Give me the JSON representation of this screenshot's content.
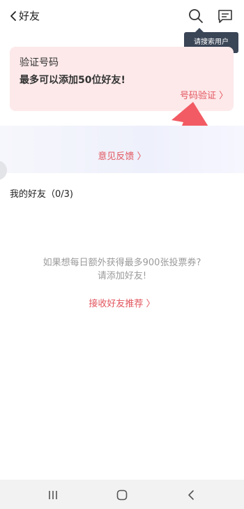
{
  "header": {
    "title": "好友",
    "back_icon": "chevron-left-icon",
    "search_icon": "search-icon",
    "message_icon": "message-icon"
  },
  "tooltip": {
    "text": "请搜索用户"
  },
  "verify_card": {
    "title": "验证号码",
    "subtitle": "最多可以添加50位好友!",
    "link": "号码验证 〉"
  },
  "feedback": {
    "label": "意见反馈 〉"
  },
  "friends": {
    "title": "我的好友（0/3)",
    "empty_line1": "如果想每日额外获得最多900张投票券?",
    "empty_line2": "请添加好友!",
    "recommend_link": "接收好友推荐 〉"
  },
  "nav": {
    "recent_icon": "recent-apps-icon",
    "home_icon": "home-icon",
    "back_icon": "back-icon"
  },
  "colors": {
    "accent": "#e2555d",
    "card_bg": "#fde9ea",
    "tooltip_bg": "#3a4556",
    "arrow": "#f25b63"
  }
}
